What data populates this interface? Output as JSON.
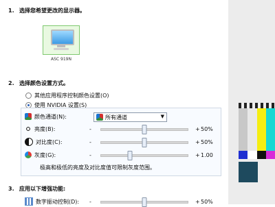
{
  "sections": {
    "s1": {
      "num": "1.",
      "title": "选择您希望更改的显示器。"
    },
    "s2": {
      "num": "2.",
      "title": "选择颜色设置方式。"
    },
    "s3": {
      "num": "3.",
      "title": "应用以下增强功能:"
    }
  },
  "monitor": {
    "name": "ASC 919N"
  },
  "color_mode": {
    "option_app": "其他应用程序控制颜色设置(O)",
    "option_nvidia": "使用 NVIDIA 设置(S)"
  },
  "channel": {
    "label": "颜色通道(N):",
    "selected": "所有通道"
  },
  "sliders": [
    {
      "icon": "brightness-icon",
      "label": "亮度(B):",
      "minus": "-",
      "plus": "+",
      "value": "50%",
      "level": 0.5
    },
    {
      "icon": "contrast-icon",
      "label": "对比度(C):",
      "minus": "-",
      "plus": "+",
      "value": "50%",
      "level": 0.5
    },
    {
      "icon": "gamma-icon",
      "label": "灰度(G):",
      "minus": "-",
      "plus": "+",
      "value": "1.00",
      "level": 0.33
    }
  ],
  "note": "极高和极低的亮度及对比度值可限制灰度范围。",
  "enhancement": {
    "label": "数字振动控制(D):",
    "minus": "-",
    "plus": "+",
    "value": "50%"
  }
}
